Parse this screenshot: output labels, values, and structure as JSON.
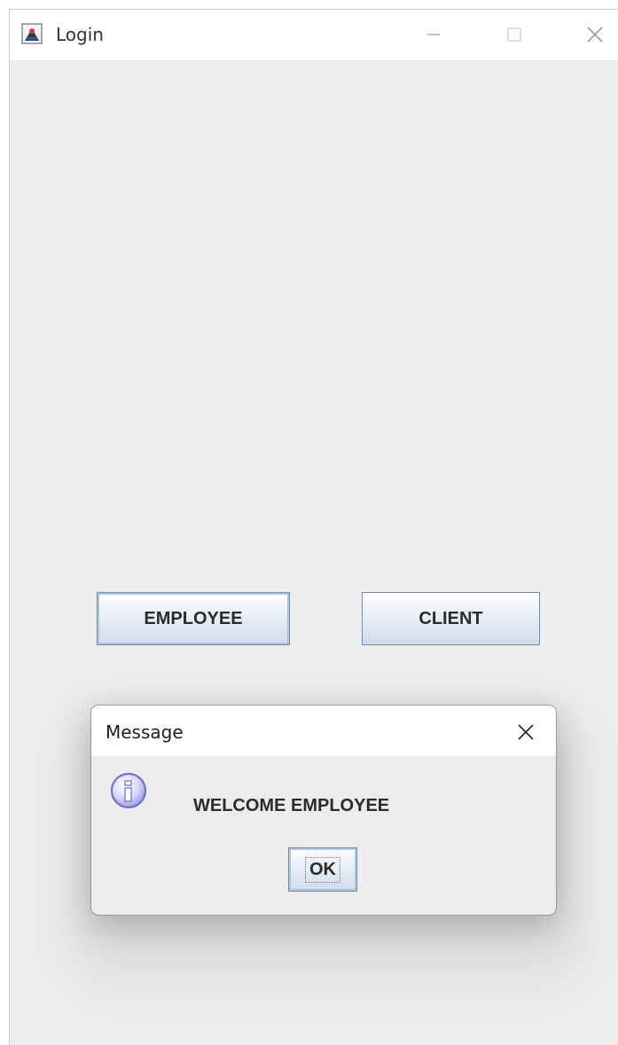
{
  "window": {
    "title": "Login",
    "icon": "java-app-icon",
    "controls": [
      "minimize-icon",
      "maximize-icon",
      "close-icon"
    ]
  },
  "main": {
    "employee_button": "EMPLOYEE",
    "client_button": "CLIENT"
  },
  "dialog": {
    "title": "Message",
    "message": "WELCOME EMPLOYEE",
    "ok_button": "OK",
    "icon": "info-icon"
  },
  "colors": {
    "window_bg": "#ededed",
    "titlebar_bg": "#ffffff",
    "button_border": "#7a8aa0",
    "focus_ring": "#a9c4e4",
    "info_icon": "#8a8ae0"
  }
}
